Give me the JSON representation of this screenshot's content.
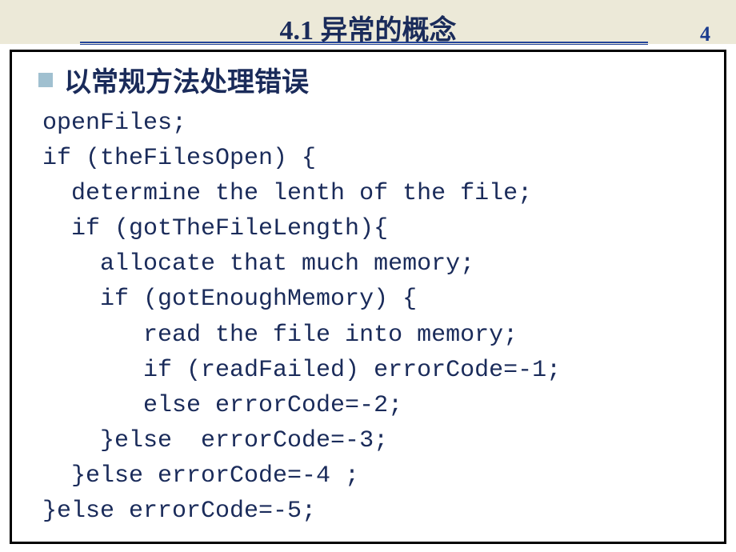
{
  "slide": {
    "title": "4.1 异常的概念",
    "page_number": "4"
  },
  "bullet": {
    "text": "以常规方法处理错误"
  },
  "code": {
    "lines": [
      "openFiles;",
      "if (theFilesOpen) {",
      "  determine the lenth of the file;",
      "  if (gotTheFileLength){",
      "    allocate that much memory;",
      "    if (gotEnoughMemory) {",
      "       read the file into memory;",
      "       if (readFailed) errorCode=-1;",
      "       else errorCode=-2;",
      "    }else  errorCode=-3;",
      "  }else errorCode=-4 ;",
      "}else errorCode=-5;"
    ]
  }
}
